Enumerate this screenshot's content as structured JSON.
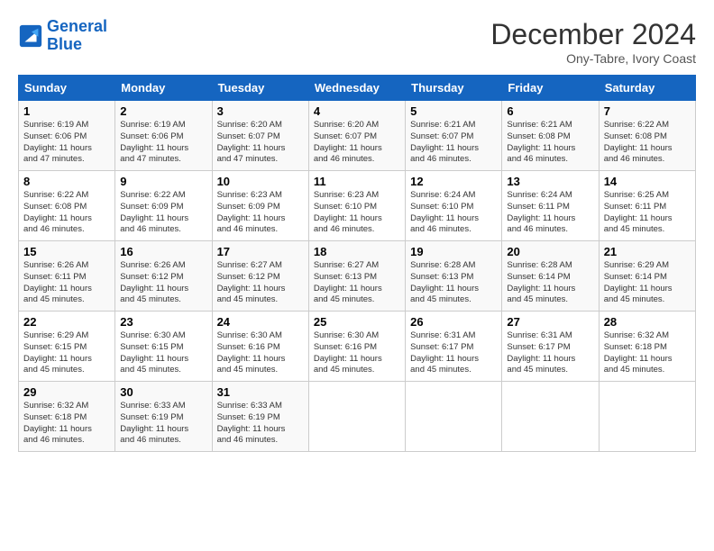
{
  "header": {
    "logo_line1": "General",
    "logo_line2": "Blue",
    "month": "December 2024",
    "location": "Ony-Tabre, Ivory Coast"
  },
  "weekdays": [
    "Sunday",
    "Monday",
    "Tuesday",
    "Wednesday",
    "Thursday",
    "Friday",
    "Saturday"
  ],
  "weeks": [
    [
      {
        "day": "1",
        "info": "Sunrise: 6:19 AM\nSunset: 6:06 PM\nDaylight: 11 hours\nand 47 minutes."
      },
      {
        "day": "2",
        "info": "Sunrise: 6:19 AM\nSunset: 6:06 PM\nDaylight: 11 hours\nand 47 minutes."
      },
      {
        "day": "3",
        "info": "Sunrise: 6:20 AM\nSunset: 6:07 PM\nDaylight: 11 hours\nand 47 minutes."
      },
      {
        "day": "4",
        "info": "Sunrise: 6:20 AM\nSunset: 6:07 PM\nDaylight: 11 hours\nand 46 minutes."
      },
      {
        "day": "5",
        "info": "Sunrise: 6:21 AM\nSunset: 6:07 PM\nDaylight: 11 hours\nand 46 minutes."
      },
      {
        "day": "6",
        "info": "Sunrise: 6:21 AM\nSunset: 6:08 PM\nDaylight: 11 hours\nand 46 minutes."
      },
      {
        "day": "7",
        "info": "Sunrise: 6:22 AM\nSunset: 6:08 PM\nDaylight: 11 hours\nand 46 minutes."
      }
    ],
    [
      {
        "day": "8",
        "info": "Sunrise: 6:22 AM\nSunset: 6:08 PM\nDaylight: 11 hours\nand 46 minutes."
      },
      {
        "day": "9",
        "info": "Sunrise: 6:22 AM\nSunset: 6:09 PM\nDaylight: 11 hours\nand 46 minutes."
      },
      {
        "day": "10",
        "info": "Sunrise: 6:23 AM\nSunset: 6:09 PM\nDaylight: 11 hours\nand 46 minutes."
      },
      {
        "day": "11",
        "info": "Sunrise: 6:23 AM\nSunset: 6:10 PM\nDaylight: 11 hours\nand 46 minutes."
      },
      {
        "day": "12",
        "info": "Sunrise: 6:24 AM\nSunset: 6:10 PM\nDaylight: 11 hours\nand 46 minutes."
      },
      {
        "day": "13",
        "info": "Sunrise: 6:24 AM\nSunset: 6:11 PM\nDaylight: 11 hours\nand 46 minutes."
      },
      {
        "day": "14",
        "info": "Sunrise: 6:25 AM\nSunset: 6:11 PM\nDaylight: 11 hours\nand 45 minutes."
      }
    ],
    [
      {
        "day": "15",
        "info": "Sunrise: 6:26 AM\nSunset: 6:11 PM\nDaylight: 11 hours\nand 45 minutes."
      },
      {
        "day": "16",
        "info": "Sunrise: 6:26 AM\nSunset: 6:12 PM\nDaylight: 11 hours\nand 45 minutes."
      },
      {
        "day": "17",
        "info": "Sunrise: 6:27 AM\nSunset: 6:12 PM\nDaylight: 11 hours\nand 45 minutes."
      },
      {
        "day": "18",
        "info": "Sunrise: 6:27 AM\nSunset: 6:13 PM\nDaylight: 11 hours\nand 45 minutes."
      },
      {
        "day": "19",
        "info": "Sunrise: 6:28 AM\nSunset: 6:13 PM\nDaylight: 11 hours\nand 45 minutes."
      },
      {
        "day": "20",
        "info": "Sunrise: 6:28 AM\nSunset: 6:14 PM\nDaylight: 11 hours\nand 45 minutes."
      },
      {
        "day": "21",
        "info": "Sunrise: 6:29 AM\nSunset: 6:14 PM\nDaylight: 11 hours\nand 45 minutes."
      }
    ],
    [
      {
        "day": "22",
        "info": "Sunrise: 6:29 AM\nSunset: 6:15 PM\nDaylight: 11 hours\nand 45 minutes."
      },
      {
        "day": "23",
        "info": "Sunrise: 6:30 AM\nSunset: 6:15 PM\nDaylight: 11 hours\nand 45 minutes."
      },
      {
        "day": "24",
        "info": "Sunrise: 6:30 AM\nSunset: 6:16 PM\nDaylight: 11 hours\nand 45 minutes."
      },
      {
        "day": "25",
        "info": "Sunrise: 6:30 AM\nSunset: 6:16 PM\nDaylight: 11 hours\nand 45 minutes."
      },
      {
        "day": "26",
        "info": "Sunrise: 6:31 AM\nSunset: 6:17 PM\nDaylight: 11 hours\nand 45 minutes."
      },
      {
        "day": "27",
        "info": "Sunrise: 6:31 AM\nSunset: 6:17 PM\nDaylight: 11 hours\nand 45 minutes."
      },
      {
        "day": "28",
        "info": "Sunrise: 6:32 AM\nSunset: 6:18 PM\nDaylight: 11 hours\nand 45 minutes."
      }
    ],
    [
      {
        "day": "29",
        "info": "Sunrise: 6:32 AM\nSunset: 6:18 PM\nDaylight: 11 hours\nand 46 minutes."
      },
      {
        "day": "30",
        "info": "Sunrise: 6:33 AM\nSunset: 6:19 PM\nDaylight: 11 hours\nand 46 minutes."
      },
      {
        "day": "31",
        "info": "Sunrise: 6:33 AM\nSunset: 6:19 PM\nDaylight: 11 hours\nand 46 minutes."
      },
      null,
      null,
      null,
      null
    ]
  ]
}
